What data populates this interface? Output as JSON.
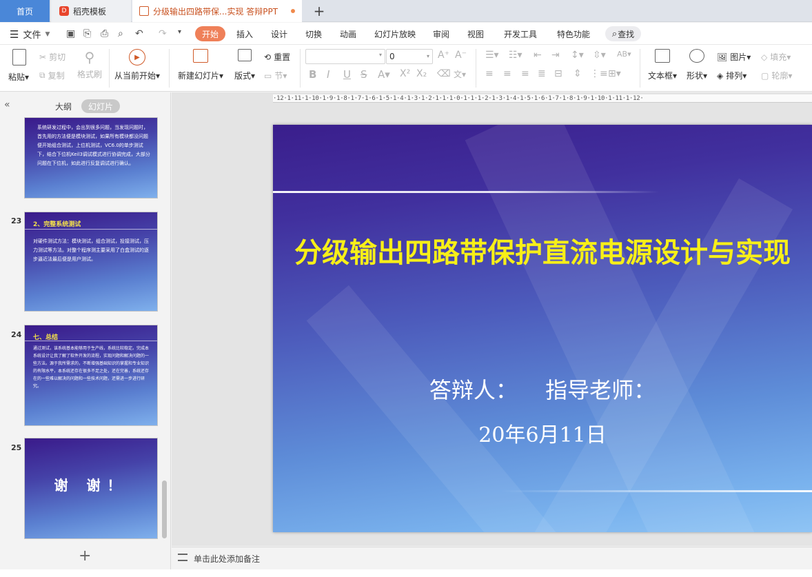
{
  "tabs": {
    "home": "首页",
    "template": "稻壳模板",
    "doc": "分级输出四路带保...实现 答辩PPT"
  },
  "menubar": {
    "file": "文件",
    "tabs": [
      "开始",
      "插入",
      "设计",
      "切换",
      "动画",
      "幻灯片放映",
      "审阅",
      "视图",
      "开发工具",
      "特色功能"
    ],
    "active_tab": "开始",
    "search": "查找"
  },
  "ribbon": {
    "paste": "粘贴",
    "cut": "剪切",
    "copy": "复制",
    "format_painter": "格式刷",
    "play_from_current": "从当前开始",
    "new_slide": "新建幻灯片",
    "layout": "版式",
    "reset": "重置",
    "section": "节",
    "font_size": "0",
    "text_box": "文本框",
    "shape": "形状",
    "picture": "图片",
    "arrange": "排列",
    "fill": "填充",
    "outline": "轮廓"
  },
  "left_panel": {
    "outline_tab": "大纲",
    "slides_tab": "幻灯片"
  },
  "thumbnails": [
    {
      "number": "",
      "title": "",
      "body": "系统研发过程中，会出到很多问题，当发现问题时，首先用的方法便是模块测试，如果所有模块都没问题便开始组合测试，上位机测试，VC6.0的单步测试下，结合下位机Keil3调试模式进行协调完成，大部分问题在下位机，如此进行反复调试进行确认。"
    },
    {
      "number": "23",
      "title": "2、完整系统测试",
      "body": "对硬件测试方法：模块测试，组合测试，投接测试，压力测试等方法。对整个程序测主要采用了白盒测试的逐步逼近法最后便是用户测试。"
    },
    {
      "number": "24",
      "title": "七、总结",
      "body": "通过测试，该系统基本能够用于生产线，系统比较稳定。完成本系统设计让我了解了软件开发的流程，实现问题和解决问题的一些方法。源于我所需求的，不断增强基础知识的掌握和专业知识的有限水平，本系统还存在很多不足之处，还在完善，系统还存在的一些难以解决的问题和一些技术问题，还需进一步进行研究。"
    },
    {
      "number": "25",
      "title": "",
      "body": "谢 谢！"
    }
  ],
  "slide": {
    "title": "分级输出四路带保护直流电源设计与实现",
    "subtitle": "答辩人： 指导老师：",
    "date": "20年6月11日"
  },
  "ruler_text": "·12·1·11·1·10·1·9·1·8·1·7·1·6·1·5·1·4·1·3·1·2·1·1·1·0·1·1·1·2·1·3·1·4·1·5·1·6·1·7·1·8·1·9·1·10·1·11·1·12·",
  "notes_placeholder": "单击此处添加备注",
  "colors": {
    "accent": "#ef8059",
    "home_tab": "#4a87d8",
    "slide_title": "#f7ef18"
  }
}
